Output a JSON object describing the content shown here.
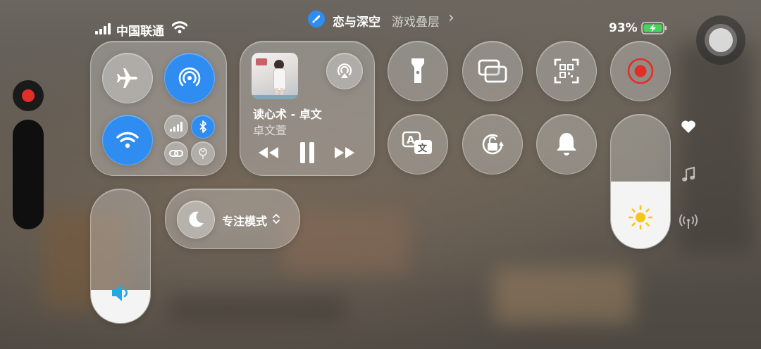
{
  "status": {
    "carrier": "中国联通",
    "battery_percent": "93%"
  },
  "top_pill": {
    "app_name": "恋与深空",
    "overlay_label": "游戏叠层",
    "chevron": "›"
  },
  "media": {
    "song_title": "读心术 - 卓文",
    "artist": "卓文萱"
  },
  "focus": {
    "label": "专注模式",
    "arrows": "⌃⌄"
  },
  "sliders": {
    "volume_level": 0.25,
    "brightness_level": 0.5
  },
  "colors": {
    "accent_blue": "#2f8cf0",
    "record_red": "#e52d27",
    "sun_yellow": "#f5c518",
    "volume_blue": "#1fa9e6",
    "battery_green": "#45d35c"
  }
}
